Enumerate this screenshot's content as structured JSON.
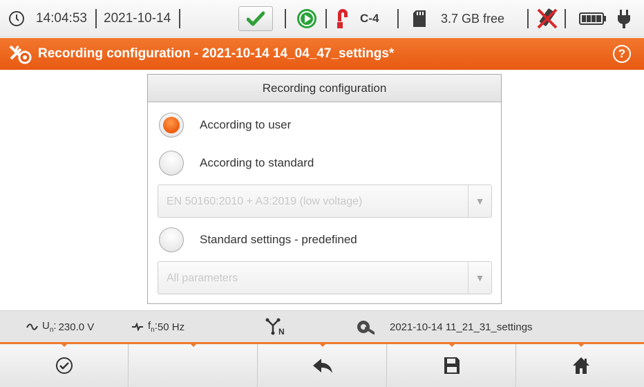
{
  "status_bar": {
    "clock_icon": "clock-icon",
    "time": "14:04:53",
    "date": "2021-10-14",
    "check_icon": "check-icon",
    "play_icon": "play-icon",
    "clamp_icon": "clamp-icon",
    "clamp_label": "C-4",
    "sd_icon": "sd-card-icon",
    "storage_free": "3.7 GB free",
    "usb_icon": "usb-disabled-icon",
    "battery_icon": "battery-icon",
    "plug_icon": "power-plug-icon"
  },
  "title_bar": {
    "icon": "settings-tools-icon",
    "title": "Recording configuration - 2021-10-14 14_04_47_settings*",
    "help": "?"
  },
  "dialog": {
    "header": "Recording configuration",
    "options": [
      {
        "label": "According to user",
        "selected": true
      },
      {
        "label": "According to standard",
        "selected": false
      },
      {
        "label": "Standard settings - predefined",
        "selected": false
      }
    ],
    "standard_select": {
      "value": "EN 50160:2010 + A3:2019 (low voltage)",
      "enabled": false
    },
    "params_select": {
      "value": "All parameters",
      "enabled": false
    }
  },
  "info_bar": {
    "voltage": "230.0 V",
    "frequency": "50 Hz",
    "network_icon": "network-3phase-n-icon",
    "settings_icon": "settings-probe-icon",
    "settings_file": "2021-10-14 11_21_31_settings"
  },
  "bottom_buttons": [
    {
      "name": "confirm-button",
      "icon": "check-circle-icon"
    },
    {
      "name": "empty-button",
      "icon": ""
    },
    {
      "name": "back-button",
      "icon": "reply-arrow-icon"
    },
    {
      "name": "save-button",
      "icon": "floppy-disk-icon"
    },
    {
      "name": "home-button",
      "icon": "home-icon"
    }
  ],
  "colors": {
    "accent": "#ec6413",
    "bar_bg": "#e5e5e5",
    "play_green": "#29a33a"
  }
}
